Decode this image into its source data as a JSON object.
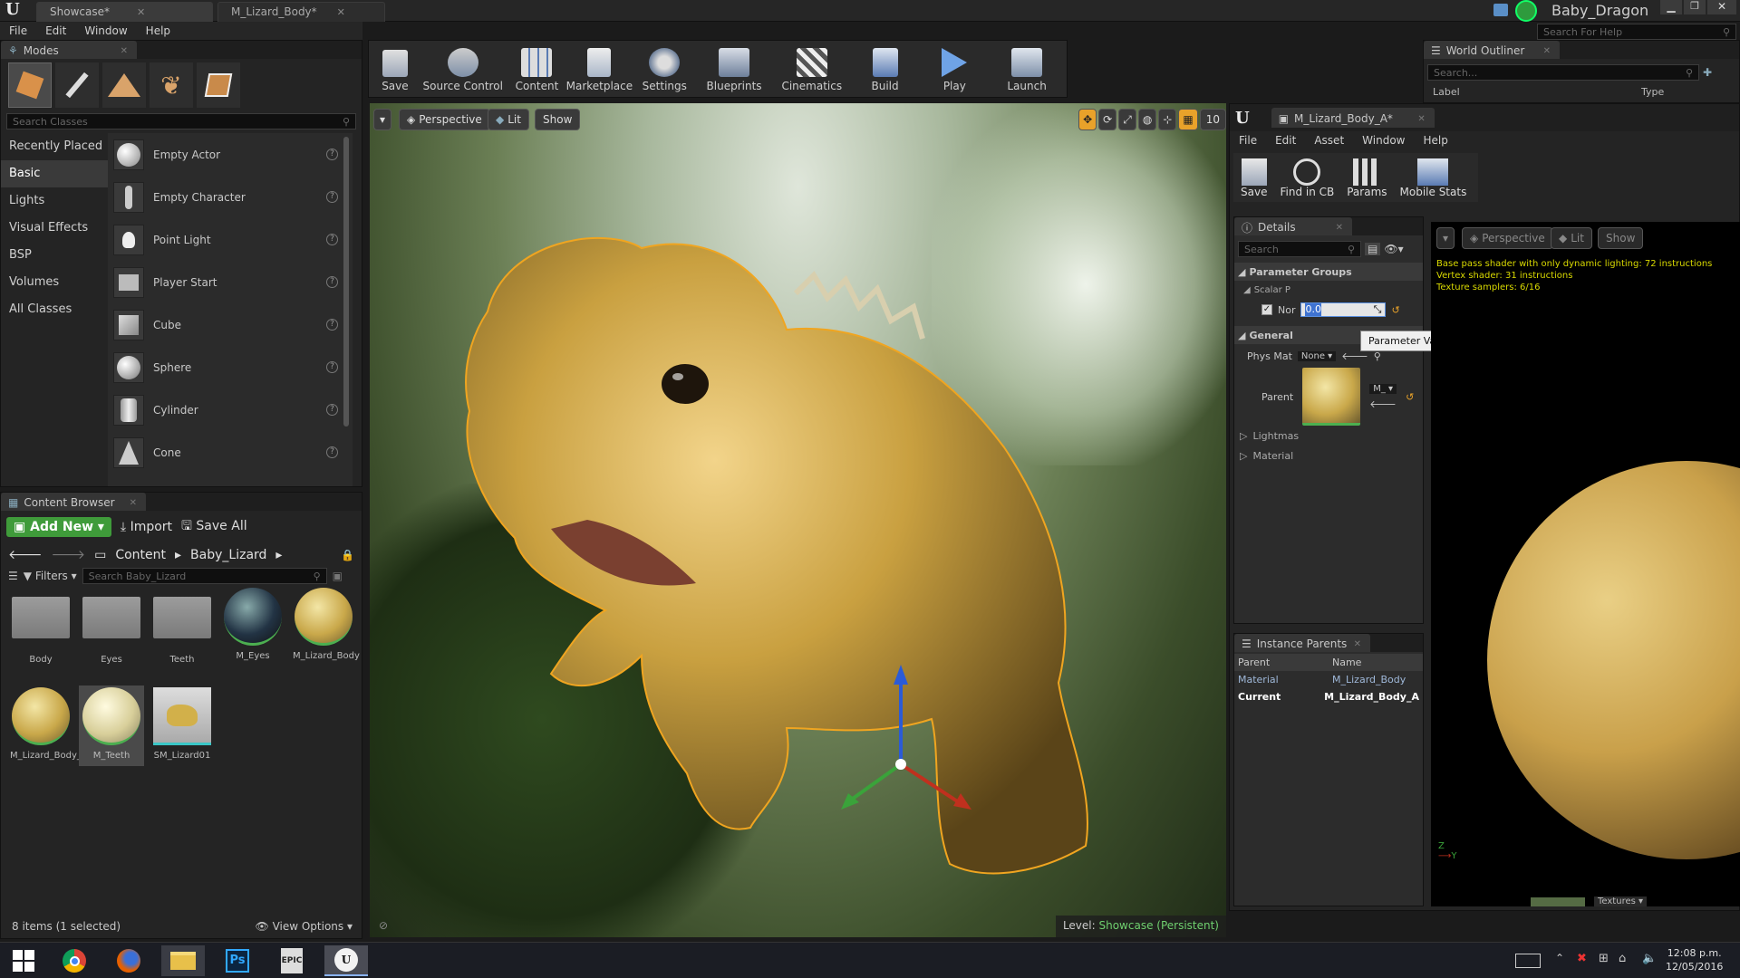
{
  "titlebar": {
    "tabs": [
      "Showcase*",
      "M_Lizard_Body*"
    ],
    "project_name": "Baby_Dragon",
    "window_controls": [
      "minimize",
      "maximize",
      "close"
    ]
  },
  "main_menu": [
    "File",
    "Edit",
    "Window",
    "Help"
  ],
  "help_search": {
    "placeholder": "Search For Help"
  },
  "modes": {
    "tab_label": "Modes",
    "search_placeholder": "Search Classes",
    "categories": [
      "Recently Placed",
      "Basic",
      "Lights",
      "Visual Effects",
      "BSP",
      "Volumes",
      "All Classes"
    ],
    "selected_category": "Basic",
    "items": [
      "Empty Actor",
      "Empty Character",
      "Point Light",
      "Player Start",
      "Cube",
      "Sphere",
      "Cylinder",
      "Cone"
    ]
  },
  "toolbar": {
    "buttons": [
      "Save",
      "Source Control",
      "Content",
      "Marketplace",
      "Settings",
      "Blueprints",
      "Cinematics",
      "Build",
      "Play",
      "Launch"
    ]
  },
  "world_outliner": {
    "tab_label": "World Outliner",
    "search_placeholder": "Search...",
    "columns": [
      "Label",
      "Type"
    ]
  },
  "content_browser": {
    "tab_label": "Content Browser",
    "add_new": "Add New",
    "import": "Import",
    "save_all": "Save All",
    "breadcrumb": [
      "Content",
      "Baby_Lizard"
    ],
    "filters": "Filters",
    "search_placeholder": "Search Baby_Lizard",
    "assets": [
      {
        "name": "Body",
        "kind": "folder"
      },
      {
        "name": "Eyes",
        "kind": "folder"
      },
      {
        "name": "Teeth",
        "kind": "folder"
      },
      {
        "name": "M_Eyes",
        "kind": "material"
      },
      {
        "name": "M_Lizard_Body",
        "kind": "material"
      },
      {
        "name": "M_Lizard_Body_A",
        "kind": "material-instance"
      },
      {
        "name": "M_Teeth",
        "kind": "material"
      },
      {
        "name": "SM_Lizard01",
        "kind": "static-mesh"
      }
    ],
    "status": "8 items (1 selected)",
    "view_options": "View Options"
  },
  "viewport": {
    "perspective": "Perspective",
    "lit": "Lit",
    "show": "Show",
    "grid_snap": "10",
    "level_label": "Level:",
    "level_name": "Showcase (Persistent)"
  },
  "material_editor": {
    "tab_label": "M_Lizard_Body_A*",
    "menu": [
      "File",
      "Edit",
      "Asset",
      "Window",
      "Help"
    ],
    "toolbar": [
      "Save",
      "Find in CB",
      "Params",
      "Mobile Stats"
    ],
    "details": {
      "tab_label": "Details",
      "search_placeholder": "Search",
      "parameter_groups": "Parameter Groups",
      "scalar_group": "Scalar P",
      "param_name": "Nor",
      "param_value": "0.0",
      "tooltip": "Parameter Value",
      "general": "General",
      "phys_mat_label": "Phys Mat",
      "phys_mat_value": "None",
      "parent_label": "Parent",
      "parent_value": "M_",
      "lightmass": "Lightmas",
      "material": "Material"
    },
    "viewport": {
      "perspective": "Perspective",
      "lit": "Lit",
      "show": "Show",
      "stats": [
        "Base pass shader with only dynamic lighting: 72 instructions",
        "Vertex shader: 31 instructions",
        "Texture samplers: 6/16"
      ],
      "bottom_label": "Textures"
    },
    "instance_parents": {
      "tab_label": "Instance Parents",
      "columns": [
        "Parent",
        "Name"
      ],
      "rows": [
        {
          "parent": "Material",
          "name": "M_Lizard_Body"
        },
        {
          "parent": "Current",
          "name": "M_Lizard_Body_A"
        }
      ]
    }
  },
  "taskbar": {
    "apps": [
      "windows-start",
      "chrome",
      "firefox",
      "file-explorer",
      "photoshop",
      "epic-games",
      "unreal-engine"
    ],
    "time": "12:08 p.m.",
    "date": "12/05/2016"
  },
  "colors": {
    "accent_green": "#5cb85c",
    "selection_orange": "#e8a22a",
    "stats_yellow": "#d9d900"
  }
}
